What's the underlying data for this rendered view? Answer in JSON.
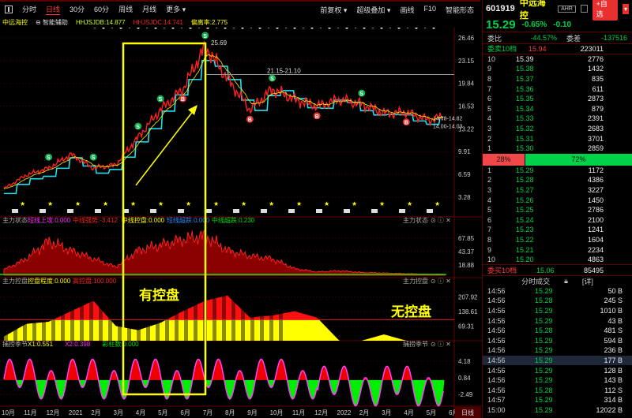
{
  "toolbar": {
    "tabs": [
      "分时",
      "日线",
      "30分",
      "60分",
      "周线",
      "月线",
      "更多 ▾"
    ],
    "active": 1,
    "right": [
      "前复权 ▾",
      "超级叠加 ▾",
      "画线",
      "F10",
      "智能形态"
    ]
  },
  "info": {
    "name": "中远海控",
    "assist": "智能辅助",
    "db": "HHJSJDB:14.877",
    "dc": "HHJSJDC:14.741",
    "lp": "偏离率:2.775"
  },
  "quote": {
    "code": "601919",
    "name": "中远海控",
    "tag": "AHR",
    "add": "+自选",
    "price": "15.29",
    "pct": "-0.65%",
    "chg": "-0.10",
    "wb_label": "委比",
    "wb": "-44.57%",
    "wc_label": "委差",
    "wc": "-137516"
  },
  "asks_header": {
    "label": "委卖10档",
    "price": "15.94",
    "vol": "223011"
  },
  "asks": [
    [
      "10",
      "15.39",
      "2776"
    ],
    [
      "9",
      "15.38",
      "1432"
    ],
    [
      "8",
      "15.37",
      "835"
    ],
    [
      "7",
      "15.36",
      "611"
    ],
    [
      "6",
      "15.35",
      "2873"
    ],
    [
      "5",
      "15.34",
      "879"
    ],
    [
      "4",
      "15.33",
      "2391"
    ],
    [
      "3",
      "15.32",
      "2683"
    ],
    [
      "2",
      "15.31",
      "3701"
    ],
    [
      "1",
      "15.30",
      "2859"
    ]
  ],
  "ratio": {
    "sell": "28%",
    "buy": "72%",
    "sell_frac": 0.28
  },
  "bids": [
    [
      "1",
      "15.29",
      "1172"
    ],
    [
      "2",
      "15.28",
      "4386"
    ],
    [
      "3",
      "15.27",
      "3227"
    ],
    [
      "4",
      "15.26",
      "1450"
    ],
    [
      "5",
      "15.25",
      "2786"
    ],
    [
      "6",
      "15.24",
      "2100"
    ],
    [
      "7",
      "15.23",
      "1241"
    ],
    [
      "8",
      "15.22",
      "1604"
    ],
    [
      "9",
      "15.21",
      "2234"
    ],
    [
      "10",
      "15.20",
      "4863"
    ]
  ],
  "bids_footer": {
    "label": "委买10档",
    "price": "15.06",
    "vol": "85495"
  },
  "trades_header": {
    "title": "分时成交",
    "detail": "[详]"
  },
  "trades": [
    [
      "14:56",
      "15.29",
      "50 B",
      "red"
    ],
    [
      "14:56",
      "15.28",
      "245 S",
      "grn"
    ],
    [
      "14:56",
      "15.29",
      "1010 B",
      "red"
    ],
    [
      "14:56",
      "15.29",
      "43 B",
      "red"
    ],
    [
      "14:56",
      "15.28",
      "481 S",
      "grn"
    ],
    [
      "14:56",
      "15.29",
      "594 B",
      "red"
    ],
    [
      "14:56",
      "15.29",
      "236 B",
      "red"
    ],
    [
      "14:56",
      "15.29",
      "177 B",
      "red"
    ],
    [
      "14:56",
      "15.29",
      "128 B",
      "red"
    ],
    [
      "14:56",
      "15.29",
      "143 B",
      "red"
    ],
    [
      "14:56",
      "15.28",
      "112 S",
      "grn"
    ],
    [
      "14:57",
      "15.29",
      "314 B",
      "red"
    ],
    [
      "15:00",
      "15.29",
      "12022 B",
      "mag"
    ]
  ],
  "chart_data": {
    "type": "line",
    "x_labels": [
      "10月",
      "11月",
      "12月",
      "2021",
      "2月",
      "3月",
      "4月",
      "5月",
      "6月",
      "7月",
      "8月",
      "9月",
      "10月",
      "11月",
      "12月",
      "2022",
      "2月",
      "3月",
      "4月",
      "5月",
      "6月"
    ],
    "period_label": "日线",
    "main": {
      "yticks": [
        "26.46",
        "23.15",
        "19.84",
        "16.53",
        "13.22",
        "9.91",
        "6.59",
        "3.28"
      ],
      "ylim": [
        3.28,
        26.46
      ],
      "close": [
        4.5,
        6.5,
        7.5,
        9.5,
        7.5,
        8,
        12,
        16,
        19,
        25.2,
        20.5,
        16,
        19,
        17.5,
        16.5,
        17.5,
        16.8,
        15.5,
        15.6,
        14.5,
        15.3
      ],
      "annotations": [
        "25.69",
        "21.15-21.10",
        "14.78-14.82",
        "14.00-14.03"
      ],
      "signals": [
        {
          "m": 2,
          "t": "S"
        },
        {
          "m": 4,
          "t": "S"
        },
        {
          "m": 6,
          "t": "S"
        },
        {
          "m": 7,
          "t": "S"
        },
        {
          "m": 8,
          "t": "B"
        },
        {
          "m": 9,
          "t": "S"
        },
        {
          "m": 11,
          "t": "B"
        },
        {
          "m": 12,
          "t": "S"
        },
        {
          "m": 14,
          "t": "B"
        },
        {
          "m": 16,
          "t": "S"
        },
        {
          "m": 18,
          "t": "B"
        }
      ]
    },
    "p1": {
      "title": "主力状态",
      "legend": [
        [
          "短线上攻:0.000",
          "#ff30ff"
        ],
        [
          "中线强势:-3.412",
          "#ff2020"
        ],
        [
          "中线控盘:0.000",
          "#ffff00"
        ],
        [
          "短线超跌:0.000",
          "#2a8cff"
        ],
        [
          "中线超跌:0.230",
          "#00e000"
        ]
      ],
      "yticks": [
        "67.85",
        "43.37",
        "18.88"
      ],
      "ylim": [
        0,
        95
      ],
      "values": [
        10,
        30,
        62,
        45,
        30,
        15,
        45,
        55,
        65,
        72,
        45,
        35,
        30,
        12,
        6,
        8,
        5,
        4,
        3,
        2,
        2
      ]
    },
    "p2": {
      "title": "主力控盘",
      "legend": [
        [
          "控盘程度:0.000",
          "#ffff00"
        ],
        [
          "高控盘:100.000",
          "#ff2020"
        ]
      ],
      "yticks": [
        "207.92",
        "138.61",
        "69.31"
      ],
      "ylim": [
        0,
        270
      ],
      "threshold": 100,
      "values": [
        20,
        80,
        90,
        140,
        190,
        70,
        50,
        85,
        140,
        190,
        215,
        110,
        120,
        140,
        110,
        0,
        0,
        30,
        0,
        0,
        0
      ]
    },
    "p3": {
      "title": "捕捞季节",
      "legend": [
        [
          "X1:0.551",
          "#ffff00"
        ],
        [
          "X2:0.398",
          "#ff30ff"
        ],
        [
          "彩柱数:0.000",
          "#00e000"
        ]
      ],
      "yticks": [
        "4.18",
        "0.84",
        "-2.49"
      ],
      "ylim": [
        -4.5,
        7
      ]
    }
  },
  "notes": {
    "with_control": "有控盘",
    "without_control": "无控盘"
  }
}
